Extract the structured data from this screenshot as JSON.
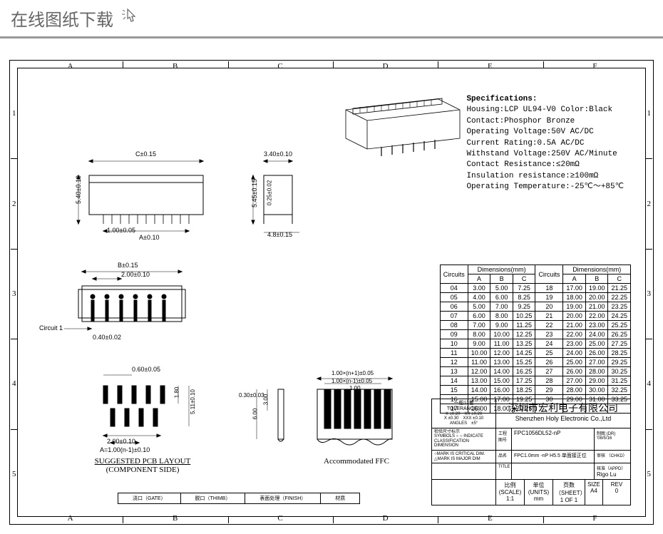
{
  "header": {
    "title": "在线图纸下载"
  },
  "grid": {
    "cols": [
      "A",
      "B",
      "C",
      "D",
      "E",
      "F"
    ],
    "rows": [
      "1",
      "2",
      "3",
      "4",
      "5"
    ]
  },
  "specs": {
    "title": "Specifications:",
    "lines": [
      "Housing:LCP UL94-V0 Color:Black",
      "Contact:Phosphor Bronze",
      "Operating Voltage:50V AC/DC",
      "Current Rating:0.5A AC/DC",
      "Withstand Voltage:250V AC/Minute",
      "Contact Resistance:≤20mΩ",
      "Insulation resistance:≥100mΩ",
      "Operating Temperature:-25℃～+85℃"
    ]
  },
  "views": {
    "top": {
      "dims": {
        "c": "C±0.15",
        "h": "5.40±0.10",
        "pitch": "1.00±0.05",
        "a": "A±0.10",
        "w": "3.40±0.10",
        "h2": "5.45±0.15",
        "t": "0.25±0.02",
        "foot": "4.8±0.15"
      }
    },
    "mid": {
      "dims": {
        "b": "B±0.15",
        "p2": "2.00±0.10",
        "circuit": "Circuit 1",
        "w": "0.40±0.02"
      }
    },
    "pcb": {
      "title1": "SUGGESTED PCB LAYOUT",
      "title2": "(COMPONENT SIDE)",
      "dims": {
        "w": "0.60±0.05",
        "h": "1.80",
        "h2": "5.11±0.10",
        "p": "2.00±0.10",
        "a": "A=1.00(n-1)±0.10"
      }
    },
    "ffc": {
      "title": "Accommodated FFC",
      "dims": {
        "w1": "1.00×(n+1)±0.05",
        "w2": "1.00×(n-1)±0.05",
        "p": "1.00",
        "t": "0.30±0.03",
        "h1": "3.00",
        "h2": "6.00"
      }
    }
  },
  "dim_table": {
    "head": {
      "circuits": "Circuits",
      "dims": "Dimensions(mm)",
      "a": "A",
      "b": "B",
      "c": "C"
    },
    "rows": [
      {
        "n": "04",
        "a": "3.00",
        "b": "5.00",
        "c": "7.25",
        "n2": "18",
        "a2": "17.00",
        "b2": "19.00",
        "c2": "21.25"
      },
      {
        "n": "05",
        "a": "4.00",
        "b": "6.00",
        "c": "8.25",
        "n2": "19",
        "a2": "18.00",
        "b2": "20.00",
        "c2": "22.25"
      },
      {
        "n": "06",
        "a": "5.00",
        "b": "7.00",
        "c": "9.25",
        "n2": "20",
        "a2": "19.00",
        "b2": "21.00",
        "c2": "23.25"
      },
      {
        "n": "07",
        "a": "6.00",
        "b": "8.00",
        "c": "10.25",
        "n2": "21",
        "a2": "20.00",
        "b2": "22.00",
        "c2": "24.25"
      },
      {
        "n": "08",
        "a": "7.00",
        "b": "9.00",
        "c": "11.25",
        "n2": "22",
        "a2": "21.00",
        "b2": "23.00",
        "c2": "25.25"
      },
      {
        "n": "09",
        "a": "8.00",
        "b": "10.00",
        "c": "12.25",
        "n2": "23",
        "a2": "22.00",
        "b2": "24.00",
        "c2": "26.25"
      },
      {
        "n": "10",
        "a": "9.00",
        "b": "11.00",
        "c": "13.25",
        "n2": "24",
        "a2": "23.00",
        "b2": "25.00",
        "c2": "27.25"
      },
      {
        "n": "11",
        "a": "10.00",
        "b": "12.00",
        "c": "14.25",
        "n2": "25",
        "a2": "24.00",
        "b2": "26.00",
        "c2": "28.25"
      },
      {
        "n": "12",
        "a": "11.00",
        "b": "13.00",
        "c": "15.25",
        "n2": "26",
        "a2": "25.00",
        "b2": "27.00",
        "c2": "29.25"
      },
      {
        "n": "13",
        "a": "12.00",
        "b": "14.00",
        "c": "16.25",
        "n2": "27",
        "a2": "26.00",
        "b2": "28.00",
        "c2": "30.25"
      },
      {
        "n": "14",
        "a": "13.00",
        "b": "15.00",
        "c": "17.25",
        "n2": "28",
        "a2": "27.00",
        "b2": "29.00",
        "c2": "31.25"
      },
      {
        "n": "15",
        "a": "14.00",
        "b": "16.00",
        "c": "18.25",
        "n2": "29",
        "a2": "28.00",
        "b2": "30.00",
        "c2": "32.25"
      },
      {
        "n": "16",
        "a": "15.00",
        "b": "17.00",
        "c": "19.25",
        "n2": "30",
        "a2": "29.00",
        "b2": "31.00",
        "c2": "33.25"
      },
      {
        "n": "17",
        "a": "16.00",
        "b": "18.00",
        "c": "20.25",
        "n2": "",
        "a2": "",
        "b2": "",
        "c2": ""
      }
    ]
  },
  "title_block": {
    "company_cn": "深圳市宏利电子有限公司",
    "company_en": "Shenzhen Holy Electronic Co.,Ltd",
    "tolerances": "一般公差\nTOLERANCES",
    "tol_lines": "X ±0.20　XX ±0.20\nX ±0.30　XXX ±0.10\nANGLES　±5°",
    "inspect": "检验尺寸标示",
    "symbols": "SYMBOLS ○ ○ INDICATE\nCLASSIFICATION DIMENSION",
    "critical": "○MARK IS CRITICAL DIM.\n△MARK IS MAJOR DIM",
    "labels": {
      "gongcheng": "工程\n图号",
      "pinming": "品名",
      "title": "TITLE",
      "zhitu": "制图 (DR)",
      "shenhe": "审核 （CHKD）",
      "hezhun": "核准（APPD）",
      "bili": "比例(SCALE)",
      "danwei": "单位(UNITS)",
      "yeci": "页数（SHEET）",
      "size": "SIZE",
      "rev": "REV"
    },
    "values": {
      "partno": "FPC1056DL52-nP",
      "desc": "FPC1.0mm -nP H5.5 单面接正位",
      "date": "'08/5/16",
      "author": "Rigo Lu",
      "scale": "1:1",
      "units": "mm",
      "sheet": "1 OF 1",
      "size": "A4",
      "rev": "0"
    },
    "bottom_labels": [
      "浇口（GATE）",
      "脱口（THIMB）",
      "表面处理（FINISH）",
      "材质"
    ]
  }
}
